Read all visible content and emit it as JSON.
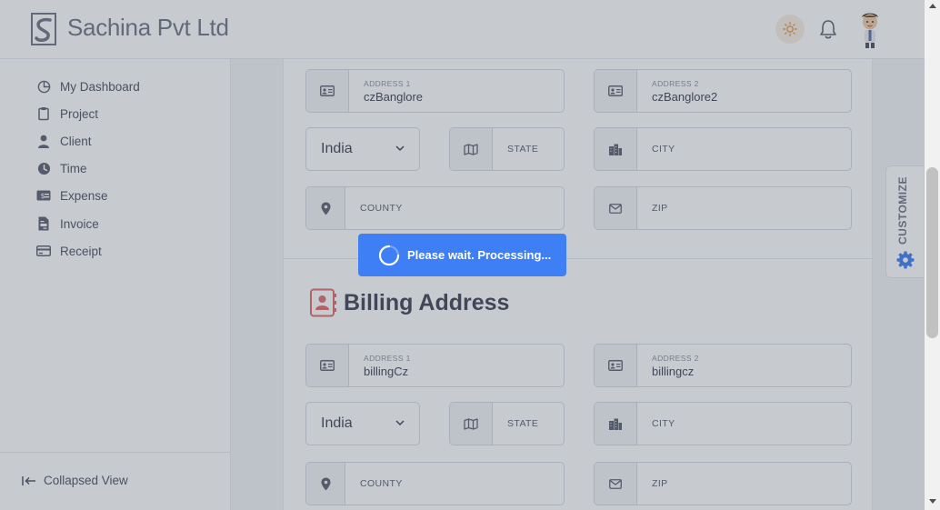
{
  "header": {
    "brand": "Sachina Pvt Ltd",
    "theme_icon": "sun-icon",
    "notification_icon": "bell-icon"
  },
  "sidebar": {
    "items": [
      {
        "label": "My Dashboard",
        "icon": "pie-chart-icon"
      },
      {
        "label": "Project",
        "icon": "clipboard-icon"
      },
      {
        "label": "Client",
        "icon": "user-icon"
      },
      {
        "label": "Time",
        "icon": "clock-icon"
      },
      {
        "label": "Expense",
        "icon": "money-icon"
      },
      {
        "label": "Invoice",
        "icon": "file-invoice-icon"
      },
      {
        "label": "Receipt",
        "icon": "credit-card-icon"
      }
    ],
    "collapse_label": "Collapsed View"
  },
  "shipping": {
    "address1_label": "ADDRESS 1",
    "address1_value": "czBanglore",
    "address2_label": "ADDRESS 2",
    "address2_value": "czBanglore2",
    "country_value": "India",
    "state_placeholder": "STATE",
    "city_placeholder": "CITY",
    "county_placeholder": "COUNTY",
    "zip_placeholder": "ZIP"
  },
  "billing": {
    "title": "Billing Address",
    "address1_label": "ADDRESS 1",
    "address1_value": "billingCz",
    "address2_label": "ADDRESS 2",
    "address2_value": "billingcz",
    "country_value": "India",
    "state_placeholder": "STATE",
    "city_placeholder": "CITY",
    "county_placeholder": "COUNTY",
    "zip_placeholder": "ZIP"
  },
  "customize_label": "CUSTOMIZE",
  "loading": {
    "message": "Please wait. Processing..."
  },
  "colors": {
    "accent": "#3e7ff5",
    "billing_icon": "#e06b6b"
  }
}
